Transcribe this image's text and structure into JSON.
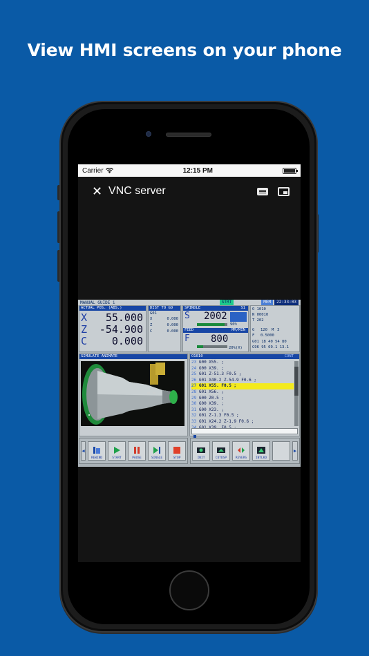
{
  "headline": "View HMI screens on your phone",
  "status_bar": {
    "carrier": "Carrier",
    "time": "12:15 PM"
  },
  "nav": {
    "title": "VNC server",
    "close_icon": "close-icon",
    "keyboard_icon": "keyboard-icon",
    "pip_icon": "picture-in-picture-icon"
  },
  "hmi": {
    "mode": "MANUAL GUIDE i",
    "status": "STRT",
    "mem": "MEM",
    "clock": "22:33:03",
    "actual_pos": {
      "header": "ACTUAL POS. (ABS.)",
      "axes": [
        {
          "axis": "X",
          "value": "55.000"
        },
        {
          "axis": "Z",
          "value": "-54.900"
        },
        {
          "axis": "C",
          "value": "0.000"
        }
      ]
    },
    "dist_to_go": {
      "header": "DIST TO GO",
      "code": "G01",
      "rows": [
        {
          "axis": "X",
          "value": "0.000"
        },
        {
          "axis": "Z",
          "value": "0.000"
        },
        {
          "axis": "C",
          "value": "0.000"
        }
      ]
    },
    "spindle": {
      "header": "SPINDLE",
      "s_label": "S",
      "value": "2002",
      "id": "S1",
      "load": "90%"
    },
    "feed": {
      "header": "FEED",
      "unit": "MM/MIN",
      "f_label": "F",
      "value": "800",
      "override": "20%(X)"
    },
    "modal": {
      "program": "O 1010",
      "seq": "N 00010",
      "tool": "T 202",
      "g_label": "G",
      "g_value": "120",
      "m_label": "M",
      "m_value": "3",
      "f_label": "F",
      "f_value": "0.5000",
      "gcodes1": "G01 18 40 54 80",
      "gcodes2": "G96 95 69.1 13.1"
    },
    "sim_header": "SIMULATE ANIMATE",
    "program": {
      "name": "O1010",
      "tag": "CONT",
      "lines": [
        {
          "n": "23",
          "text": "G00 X55. ;"
        },
        {
          "n": "24",
          "text": "G00 X39. ;"
        },
        {
          "n": "25",
          "text": "G01 Z-51.3 F0.5 ;"
        },
        {
          "n": "26",
          "text": "G01 X40.2 Z-54.9 F0.6 ;"
        },
        {
          "n": "27",
          "text": "G01 X55. F0.5 ;"
        },
        {
          "n": "28",
          "text": "G01 X56. ;"
        },
        {
          "n": "29",
          "text": "G00 Z0.5 ;"
        },
        {
          "n": "30",
          "text": "G00 X39. ;"
        },
        {
          "n": "31",
          "text": "G00 X23. ;"
        },
        {
          "n": "32",
          "text": "G01 Z-1.3 F0.5 ;"
        },
        {
          "n": "33",
          "text": "G01 X24.2 Z-1.9 F0.6 ;"
        },
        {
          "n": "34",
          "text": "G01 X39. F0.5 ;"
        }
      ],
      "highlight_index": 4
    },
    "softkeys_left": [
      "REWIND",
      "START",
      "PAUSE",
      "SINGLE",
      "STOP"
    ],
    "softkeys_right": [
      "INIT",
      "CUTDSP",
      "REVERS",
      "INTLKD"
    ]
  }
}
